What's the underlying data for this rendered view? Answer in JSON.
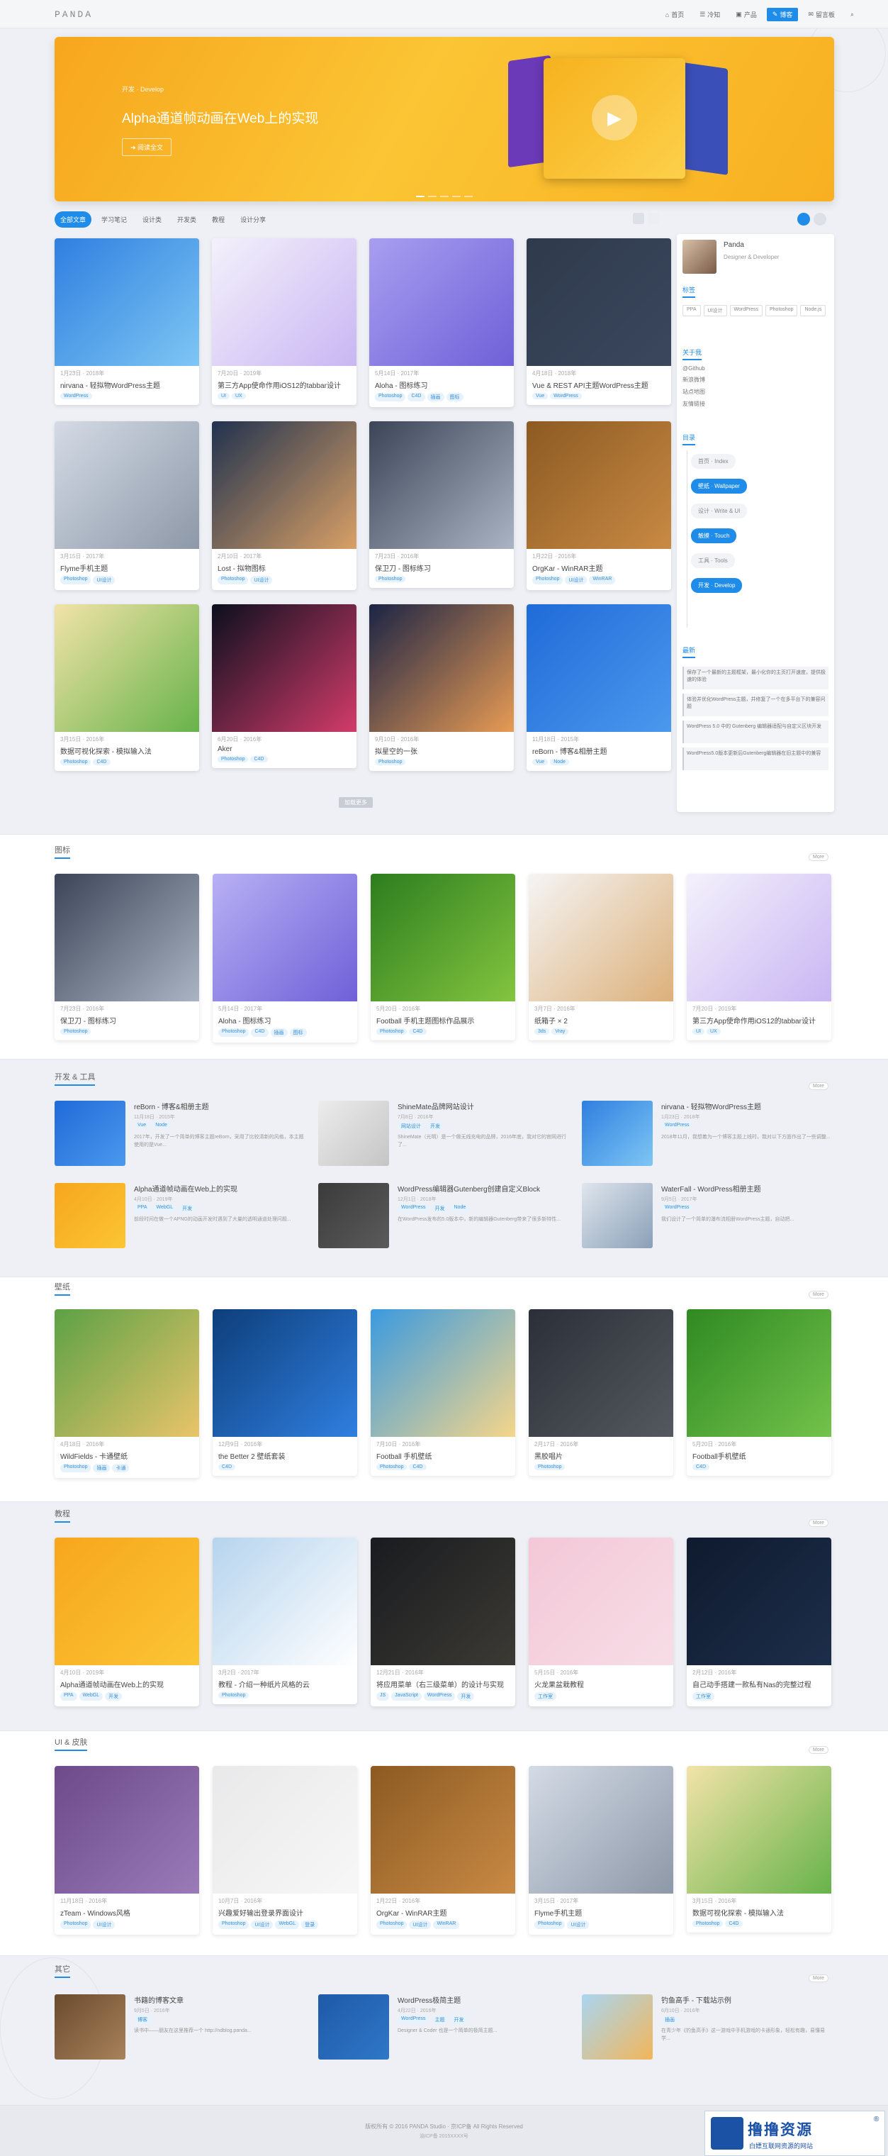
{
  "header": {
    "logo": "PANDA",
    "nav": [
      {
        "label": "首页"
      },
      {
        "label": "冷知"
      },
      {
        "label": "产品"
      },
      {
        "label": "博客",
        "active": true
      },
      {
        "label": "留言板"
      }
    ],
    "search_icon": "search-icon"
  },
  "hero": {
    "sub": "开发 · Develop",
    "title": "Alpha通道帧动画在Web上的实现",
    "button": "阅读全文"
  },
  "cats": [
    {
      "label": "全部文章",
      "active": true
    },
    {
      "label": "学习笔记"
    },
    {
      "label": "设计类"
    },
    {
      "label": "开发类"
    },
    {
      "label": "教程"
    },
    {
      "label": "设计分享"
    }
  ],
  "grid": [
    {
      "meta": "1月23日 · 2018年",
      "name": "nirvana - 轻拟物WordPress主题",
      "tags": [
        "WordPress"
      ],
      "c1": "#2f7fe0",
      "c2": "#7ec6f4"
    },
    {
      "meta": "7月20日 · 2019年",
      "name": "第三方App使命作用iOS12的tabbar设计",
      "tags": [
        "UI",
        "UX"
      ],
      "c1": "#f4f1fb",
      "c2": "#c9b6f3"
    },
    {
      "meta": "5月14日 · 2017年",
      "name": "Aloha - 图标练习",
      "tags": [
        "Photoshop",
        "C4D",
        "插画",
        "图标"
      ],
      "c1": "#a89ef0",
      "c2": "#6f60d8"
    },
    {
      "meta": "4月18日 · 2018年",
      "name": "Vue & REST API主题WordPress主题",
      "tags": [
        "Vue",
        "WordPress"
      ],
      "c1": "#2f3a4c",
      "c2": "#3a475d"
    },
    {
      "meta": "3月15日 · 2017年",
      "name": "Flyme手机主题",
      "tags": [
        "Photoshop",
        "UI设计"
      ],
      "c1": "#d4dbe6",
      "c2": "#8d98a8"
    },
    {
      "meta": "2月10日 · 2017年",
      "name": "Lost - 拟物图标",
      "tags": [
        "Photoshop",
        "UI设计"
      ],
      "c1": "#20324f",
      "c2": "#d9a066"
    },
    {
      "meta": "7月23日 · 2016年",
      "name": "保卫刀 - 图标练习",
      "tags": [
        "Photoshop"
      ],
      "c1": "#3b4557",
      "c2": "#aab4c4"
    },
    {
      "meta": "1月22日 · 2016年",
      "name": "OrgKar - WinRAR主题",
      "tags": [
        "Photoshop",
        "UI设计",
        "WinRAR"
      ],
      "c1": "#8c5a22",
      "c2": "#c98a44"
    },
    {
      "meta": "3月15日 · 2016年",
      "name": "数据可视化探索 - 模拟输入法",
      "tags": [
        "Photoshop",
        "C4D"
      ],
      "c1": "#f2e3a8",
      "c2": "#67b34a"
    },
    {
      "meta": "6月20日 · 2016年",
      "name": "Aker",
      "tags": [
        "Photoshop",
        "C4D"
      ],
      "c1": "#0b0f1e",
      "c2": "#d33b6a"
    },
    {
      "meta": "9月10日 · 2016年",
      "name": "拟星空的一张",
      "tags": [
        "Photoshop"
      ],
      "c1": "#1b2445",
      "c2": "#e89b54"
    },
    {
      "meta": "11月18日 · 2015年",
      "name": "reBorn - 博客&相册主题",
      "tags": [
        "Vue",
        "Node"
      ],
      "c1": "#1f6bd8",
      "c2": "#4b98ee"
    }
  ],
  "sidebar": {
    "name": "Panda",
    "desc": "Designer & Developer",
    "tags_h": "标签",
    "tags": [
      "PPA",
      "UI设计",
      "WordPress",
      "Photoshop",
      "Node.js"
    ],
    "links_h": "关于我",
    "links": [
      "@Github",
      "新浪微博",
      "站点地图",
      "友情链接"
    ],
    "tl_h": "目录",
    "timeline": [
      {
        "label": "首页 · Index",
        "on": false
      },
      {
        "label": "壁纸 · Wallpaper",
        "on": true
      },
      {
        "label": "设计 · Write & UI",
        "on": false
      },
      {
        "label": "触摸 · Touch",
        "on": true
      },
      {
        "label": "工具 · Tools",
        "on": false
      },
      {
        "label": "开发 · Develop",
        "on": true
      }
    ],
    "news_h": "最新",
    "news": [
      "保存了一个最新的主题框架，最小化你的主页打开速度，提供极速的体验",
      "体验并优化WordPress主题，并修复了一个在多平台下的兼容问题",
      "WordPress 5.0 中的 Gutenberg 编辑器适配与自定义区块开发",
      "WordPress5.0版本更新后Gutenberg编辑器在旧主题中的兼容"
    ]
  },
  "load_more": "加载更多",
  "sections": {
    "icons": "图标",
    "dev": "开发 & 工具",
    "wallpaper": "壁纸",
    "tutorial": "教程",
    "ui": "UI & 皮肤",
    "other": "其它",
    "more": "More"
  },
  "icons_cards": [
    {
      "meta": "7月23日 · 2016年",
      "name": "保卫刀 - 图标练习",
      "tags": [
        "Photoshop"
      ],
      "c1": "#3b4557",
      "c2": "#aab4c4"
    },
    {
      "meta": "5月14日 · 2017年",
      "name": "Aloha - 图标练习",
      "tags": [
        "Photoshop",
        "C4D",
        "插画",
        "图标"
      ],
      "c1": "#b8b0f4",
      "c2": "#6f60d8"
    },
    {
      "meta": "5月20日 · 2016年",
      "name": "Football 手机主题图标作品展示",
      "tags": [
        "Photoshop",
        "C4D"
      ],
      "c1": "#2c7d1f",
      "c2": "#84c53f"
    },
    {
      "meta": "3月7日 · 2016年",
      "name": "纸箱子 × 2",
      "tags": [
        "3ds",
        "Vray"
      ],
      "c1": "#f5f5f5",
      "c2": "#dcb07a"
    },
    {
      "meta": "7月20日 · 2019年",
      "name": "第三方App使命作用iOS12的tabbar设计",
      "tags": [
        "UI",
        "UX"
      ],
      "c1": "#f4f1fb",
      "c2": "#c9b6f3"
    }
  ],
  "dev_rows": [
    {
      "title": "reBorn - 博客&相册主题",
      "meta": "11月18日 · 2015年",
      "tags": [
        "Vue",
        "Node"
      ],
      "desc": "2017年，开发了一个简单的博客主题reBorn，采用了比较清新的风格，本主题使用的是Vue...",
      "c1": "#1f6bd8",
      "c2": "#4b98ee"
    },
    {
      "title": "ShineMate品牌网站设计",
      "meta": "7月8日 · 2016年",
      "tags": [
        "网站设计",
        "开发"
      ],
      "desc": "ShineMate（光明）是一个做无线充电的品牌，2016年底，我对它的官网进行了...",
      "c1": "#ececec",
      "c2": "#c5c5c5"
    },
    {
      "title": "nirvana - 轻拟物WordPress主题",
      "meta": "1月23日 · 2018年",
      "tags": [
        "WordPress"
      ],
      "desc": "2018年11月，我想着为一个博客主题上线时，我对以下方面作出了一些调整...",
      "c1": "#2f7fe0",
      "c2": "#7ec6f4"
    },
    {
      "title": "Alpha通道帧动画在Web上的实现",
      "meta": "4月10日 · 2019年",
      "tags": [
        "PPA",
        "WebGL",
        "开发"
      ],
      "desc": "前段时间在做一个APNG的动画开发时遇到了大量的透明通道处理问题...",
      "c1": "#f7a61d",
      "c2": "#fbc534"
    },
    {
      "title": "WordPress编辑器Gutenberg创建自定义Block",
      "meta": "12月1日 · 2018年",
      "tags": [
        "WordPress",
        "开发",
        "Node"
      ],
      "desc": "在WordPress发布的5.0版本中，新的编辑器Gutenberg带来了很多新特性...",
      "c1": "#3b3b3b",
      "c2": "#5b5b5b"
    },
    {
      "title": "WaterFall - WordPress相册主题",
      "meta": "9月5日 · 2017年",
      "tags": [
        "WordPress"
      ],
      "desc": "我们设计了一个简单的瀑布流相册WordPress主题，自动把...",
      "c1": "#dfe5ec",
      "c2": "#8aa0b8"
    }
  ],
  "wall_cards": [
    {
      "meta": "4月18日 · 2016年",
      "name": "WildFields - 卡通壁纸",
      "tags": [
        "Photoshop",
        "插画",
        "卡通"
      ],
      "c1": "#5da145",
      "c2": "#e9c46a"
    },
    {
      "meta": "12月9日 · 2016年",
      "name": "the Better 2 壁纸套装",
      "tags": [
        "C4D"
      ],
      "c1": "#0d3e7a",
      "c2": "#2f7fe0"
    },
    {
      "meta": "7月10日 · 2016年",
      "name": "Football 手机壁纸",
      "tags": [
        "Photoshop",
        "C4D"
      ],
      "c1": "#3a9ae0",
      "c2": "#f5d68a"
    },
    {
      "meta": "2月17日 · 2016年",
      "name": "黑胶唱片",
      "tags": [
        "Photoshop"
      ],
      "c1": "#2b2f38",
      "c2": "#54595f"
    },
    {
      "meta": "5月20日 · 2016年",
      "name": "Football手机壁纸",
      "tags": [
        "C4D"
      ],
      "c1": "#2f8a22",
      "c2": "#73c24b"
    }
  ],
  "tut_cards": [
    {
      "meta": "4月10日 · 2019年",
      "name": "Alpha通道帧动画在Web上的实现",
      "tags": [
        "PPA",
        "WebGL",
        "开发"
      ],
      "c1": "#f7a61d",
      "c2": "#fbc534"
    },
    {
      "meta": "3月2日 · 2017年",
      "name": "教程 - 介绍一种纸片风格的云",
      "tags": [
        "Photoshop"
      ],
      "c1": "#b6d4ee",
      "c2": "#ffffff"
    },
    {
      "meta": "12月21日 · 2016年",
      "name": "将应用菜单（右三级菜单）的设计与实现",
      "tags": [
        "JS",
        "JavaScript",
        "WordPress",
        "开发"
      ],
      "c1": "#1a1b1f",
      "c2": "#3b3a34"
    },
    {
      "meta": "5月15日 · 2016年",
      "name": "火龙果盆栽教程",
      "tags": [
        "工作室"
      ],
      "c1": "#f3c7d7",
      "c2": "#f7dde6"
    },
    {
      "meta": "2月12日 · 2016年",
      "name": "自己动手搭建一款私有Nas的完整过程",
      "tags": [
        "工作室"
      ],
      "c1": "#0f1a2e",
      "c2": "#1d2e4a"
    }
  ],
  "ui_cards": [
    {
      "meta": "11月18日 · 2016年",
      "name": "zTeam - Windows风格",
      "tags": [
        "Photoshop",
        "UI设计"
      ],
      "c1": "#6d4a8a",
      "c2": "#9a7bb8"
    },
    {
      "meta": "10月7日 · 2016年",
      "name": "兴趣爱好输出登录界面设计",
      "tags": [
        "Photoshop",
        "UI设计",
        "WebGL",
        "登录"
      ],
      "c1": "#e9e9ea",
      "c2": "#f7f7f7"
    },
    {
      "meta": "1月22日 · 2016年",
      "name": "OrgKar - WinRAR主题",
      "tags": [
        "Photoshop",
        "UI设计",
        "WinRAR"
      ],
      "c1": "#8c5a22",
      "c2": "#c98a44"
    },
    {
      "meta": "3月15日 · 2017年",
      "name": "Flyme手机主题",
      "tags": [
        "Photoshop",
        "UI设计"
      ],
      "c1": "#d4dbe6",
      "c2": "#8d98a8"
    },
    {
      "meta": "3月15日 · 2016年",
      "name": "数据可视化探索 - 模拟输入法",
      "tags": [
        "Photoshop",
        "C4D"
      ],
      "c1": "#f2e3a8",
      "c2": "#67b34a"
    }
  ],
  "other_rows": [
    {
      "title": "书籍的博客文章",
      "meta": "9月5日 · 2016年",
      "tags": [
        "博客"
      ],
      "desc": "读书中——朋友在这里推荐一个 http://ndblog.panda...",
      "c1": "#6b4a2e",
      "c2": "#a8825a"
    },
    {
      "title": "WordPress极简主题",
      "meta": "4月22日 · 2016年",
      "tags": [
        "WordPress",
        "主题",
        "开发"
      ],
      "desc": "Designer & Coder 也是一个简单的极简主题...",
      "c1": "#1e5aa8",
      "c2": "#2f77c8"
    },
    {
      "title": "钓鱼高手 - 下载站示例",
      "meta": "6月10日 · 2016年",
      "tags": [
        "插画"
      ],
      "desc": "在青少年《钓鱼高手》这一游戏中手机游戏的卡通形象，轻松有趣，易懂易学...",
      "c1": "#a9d6f2",
      "c2": "#f2b65a"
    }
  ],
  "footer": {
    "copyright": "版权所有 © 2016 PANDA Studio · 京ICP备 All Rights Reserved",
    "sub": "渝ICP备 2015XXXX号"
  },
  "badge": {
    "title": "撸撸资源",
    "sub": "白嫖互联网资源的网站",
    "reg": "®"
  }
}
